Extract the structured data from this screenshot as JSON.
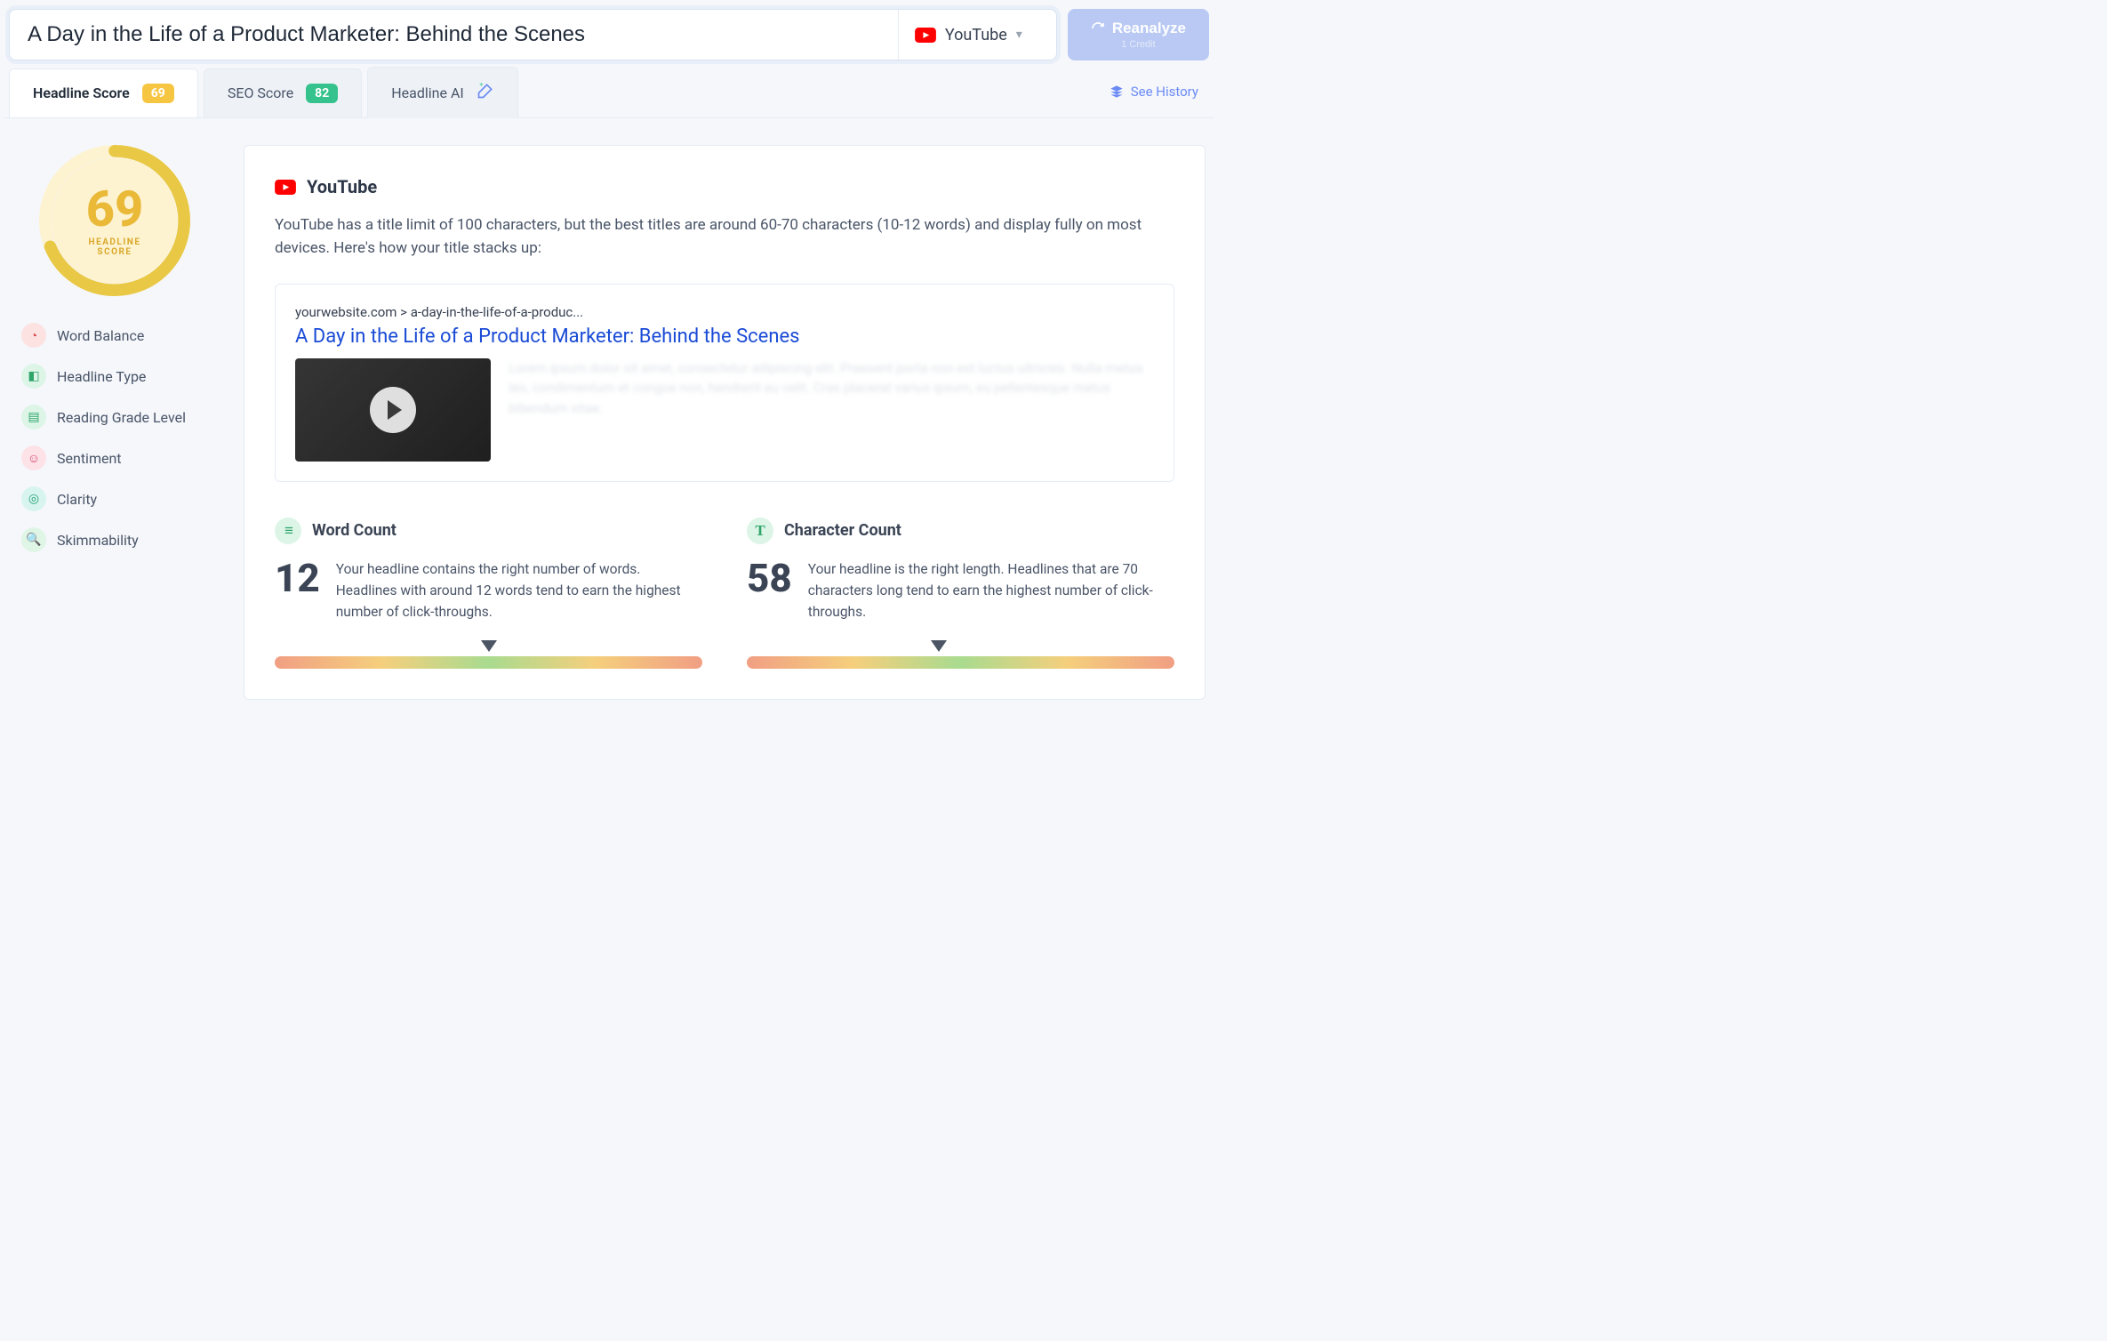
{
  "headline_input": "A Day in the Life of a Product Marketer: Behind the Scenes",
  "platform": {
    "name": "YouTube"
  },
  "reanalyze": {
    "label": "Reanalyze",
    "credit": "1 Credit"
  },
  "tabs": {
    "headline": {
      "label": "Headline Score",
      "badge": "69"
    },
    "seo": {
      "label": "SEO Score",
      "badge": "82"
    },
    "ai": {
      "label": "Headline AI"
    }
  },
  "see_history": "See History",
  "sidebar": {
    "score": "69",
    "score_caption": "HEADLINE\nSCORE",
    "metrics": [
      {
        "icon": "pie",
        "label": "Word Balance"
      },
      {
        "icon": "shapes",
        "label": "Headline Type"
      },
      {
        "icon": "book",
        "label": "Reading Grade Level"
      },
      {
        "icon": "face",
        "label": "Sentiment"
      },
      {
        "icon": "target",
        "label": "Clarity"
      },
      {
        "icon": "magnifier",
        "label": "Skimmability"
      }
    ]
  },
  "panel": {
    "title": "YouTube",
    "description": "YouTube has a title limit of 100 characters, but the best titles are around 60-70 characters (10-12 words) and display fully on most devices. Here's how your title stacks up:",
    "preview": {
      "url": "yourwebsite.com > a-day-in-the-life-of-a-produc...",
      "title": "A Day in the Life of a Product Marketer: Behind the Scenes",
      "lorem": "Lorem ipsum dolor sit amet, consectetur adipiscing elit. Praesent porta non est luctus ultricies. Nulla metus leo, condimentum et congue non, hendrerit eu velit. Cras placerat varius ipsum, eu pellentesque metus bibendum vitae."
    },
    "word_count": {
      "title": "Word Count",
      "value": "12",
      "desc": "Your headline contains the right number of words. Headlines with around 12 words tend to earn the highest number of click-throughs.",
      "marker_percent": 50
    },
    "char_count": {
      "title": "Character Count",
      "value": "58",
      "desc": "Your headline is the right length. Headlines that are 70 characters long tend to earn the highest number of click-throughs.",
      "marker_percent": 45
    }
  }
}
